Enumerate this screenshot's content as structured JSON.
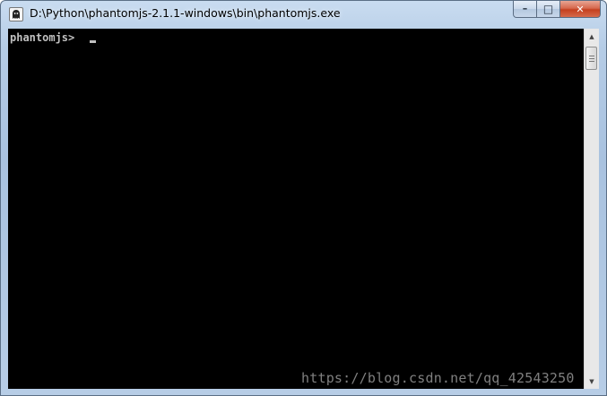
{
  "window": {
    "title": "D:\\Python\\phantomjs-2.1.1-windows\\bin\\phantomjs.exe",
    "controls": {
      "minimize_glyph": "–",
      "maximize_glyph": "□",
      "close_glyph": "✕"
    }
  },
  "console": {
    "prompt": "phantomjs> ",
    "text_color": "#c0c0c0",
    "background": "#000000"
  },
  "scrollbar": {
    "up_glyph": "▲",
    "down_glyph": "▼"
  },
  "watermark": {
    "text": "https://blog.csdn.net/qq_42543250"
  },
  "icons": {
    "app": "phantomjs-ghost-icon",
    "minimize": "minimize-icon",
    "maximize": "maximize-icon",
    "close": "close-icon"
  }
}
